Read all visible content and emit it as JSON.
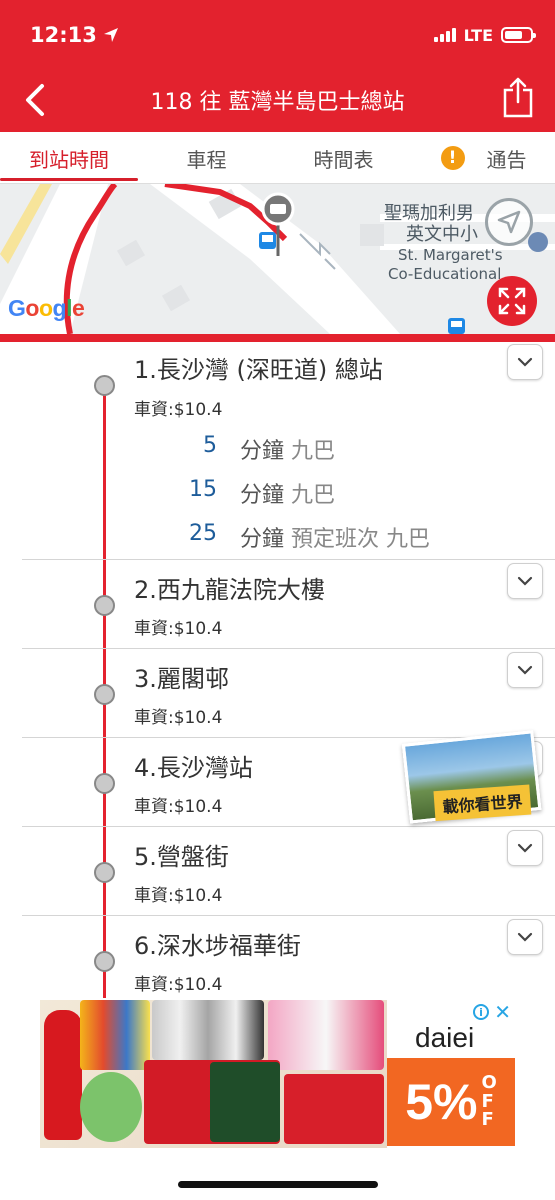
{
  "status_bar": {
    "time": "12:13",
    "network": "LTE",
    "battery_level": 0.7
  },
  "header": {
    "title": "118 往 藍灣半島巴士總站"
  },
  "tabs": [
    {
      "label": "到站時間",
      "active": true
    },
    {
      "label": "車程",
      "active": false
    },
    {
      "label": "時間表",
      "active": false
    },
    {
      "label": "通告",
      "active": false,
      "alert_icon": "!"
    }
  ],
  "map": {
    "poi_lines": [
      "聖瑪加利男",
      "英文中小",
      "St. Margaret's",
      "Co-Educational"
    ],
    "provider": "Google",
    "colors": {
      "route": "#e3222e",
      "bus_stop": "#1e88e5"
    }
  },
  "stops": [
    {
      "name": "1.長沙灣 (深旺道) 總站",
      "fare": "車資:$10.4",
      "etas": [
        {
          "minutes": "5",
          "unit": "分鐘",
          "extra": "九巴"
        },
        {
          "minutes": "15",
          "unit": "分鐘",
          "extra": "九巴"
        },
        {
          "minutes": "25",
          "unit": "分鐘",
          "extra": "預定班次 九巴"
        }
      ]
    },
    {
      "name": "2.西九龍法院大樓",
      "fare": "車資:$10.4"
    },
    {
      "name": "3.麗閣邨",
      "fare": "車資:$10.4"
    },
    {
      "name": "4.長沙灣站",
      "fare": "車資:$10.4"
    },
    {
      "name": "5.營盤街",
      "fare": "車資:$10.4"
    },
    {
      "name": "6.深水埗福華街",
      "fare": "車資:$10.4"
    }
  ],
  "promo": {
    "label": "載你看世界"
  },
  "ad": {
    "brand": "daiei",
    "discount": "5%",
    "off_letters": [
      "O",
      "F",
      "F"
    ]
  },
  "theme": {
    "primary": "#e3222e",
    "eta_color": "#1d5c9a",
    "alert": "#f39c12"
  }
}
